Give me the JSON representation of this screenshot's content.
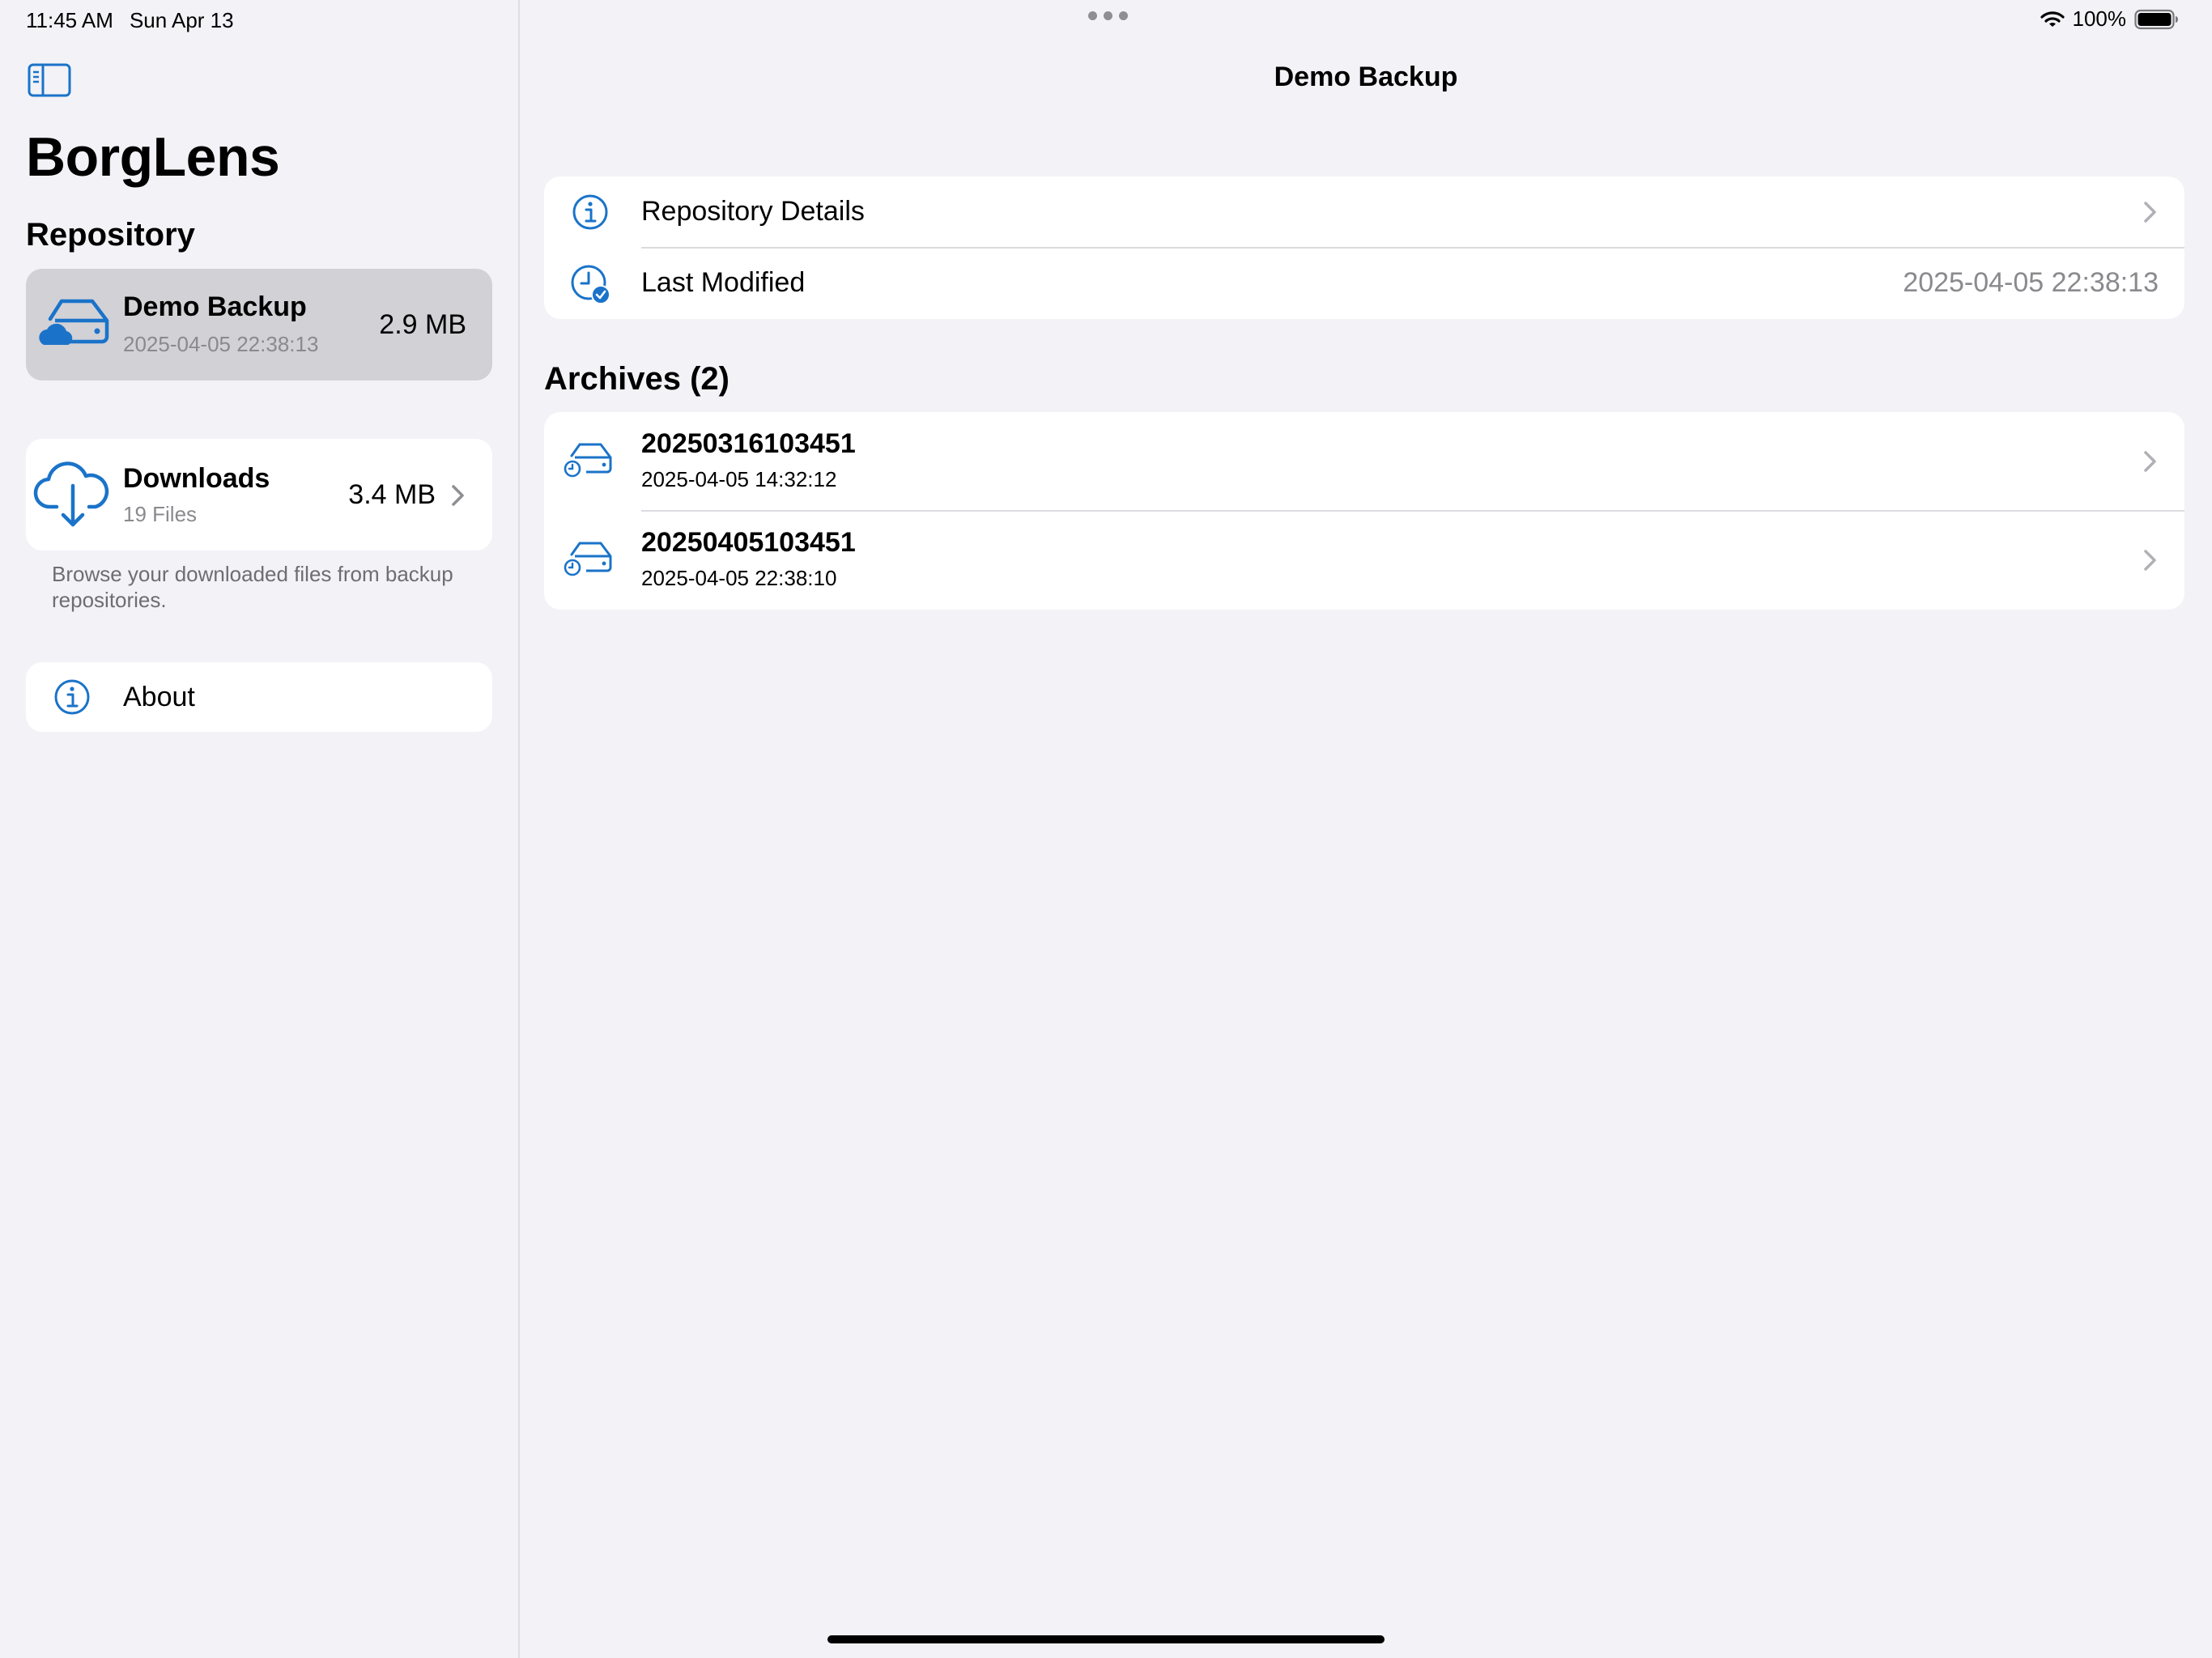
{
  "status_bar": {
    "time": "11:45 AM",
    "date": "Sun Apr 13",
    "battery": "100%"
  },
  "sidebar": {
    "app_title": "BorgLens",
    "section_header": "Repository",
    "repository": {
      "name": "Demo Backup",
      "date": "2025-04-05 22:38:13",
      "size": "2.9 MB"
    },
    "downloads": {
      "title": "Downloads",
      "subtitle": "19 Files",
      "size": "3.4 MB",
      "footer": "Browse your downloaded files from backup repositories."
    },
    "about": {
      "label": "About"
    }
  },
  "main": {
    "nav_title": "Demo Backup",
    "details": {
      "repository_details_label": "Repository Details",
      "last_modified_label": "Last Modified",
      "last_modified_value": "2025-04-05 22:38:13"
    },
    "archives_header": "Archives (2)",
    "archives": [
      {
        "name": "20250316103451",
        "date": "2025-04-05 14:32:12"
      },
      {
        "name": "20250405103451",
        "date": "2025-04-05 22:38:10"
      }
    ]
  },
  "colors": {
    "accent": "#1a73c9",
    "background": "#f2f2f7",
    "selected_row": "#d1d1d6",
    "secondary_text": "#8a8a8e"
  },
  "icons": {
    "sidebar_toggle": "sidebar-toggle-icon",
    "repository": "cloud-drive-icon",
    "downloads": "cloud-download-icon",
    "about": "info-circle-icon",
    "repository_details": "info-circle-icon",
    "last_modified": "clock-check-icon",
    "archive": "drive-history-icon",
    "disclosure": "chevron-right-icon"
  }
}
